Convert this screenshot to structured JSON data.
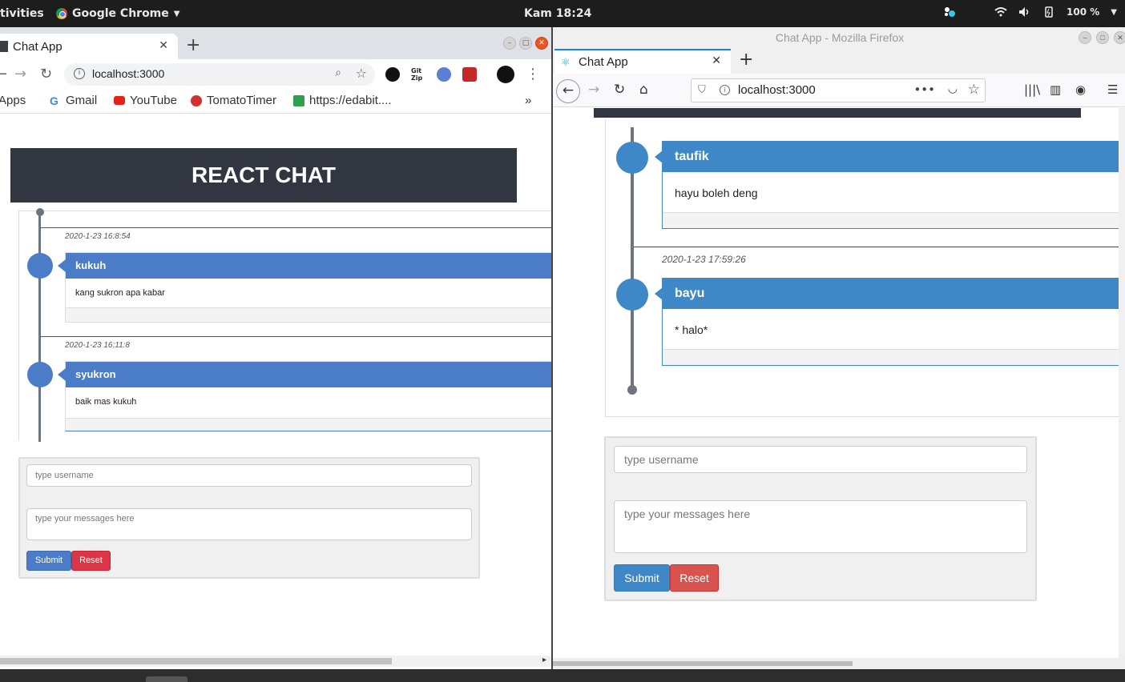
{
  "system": {
    "activities": "tivities",
    "app_name": "Google Chrome",
    "clock": "Kam 18:24",
    "battery": "100 %"
  },
  "chrome": {
    "tab_title": "Chat App",
    "url": "localhost:3000",
    "bookmarks": [
      "Apps",
      "Gmail",
      "YouTube",
      "TomatoTimer",
      "https://edabit...."
    ],
    "page": {
      "header": "REACT CHAT",
      "messages": [
        {
          "date": "2020-1-23 16:8:54",
          "user": "kukuh",
          "text": "kang sukron apa kabar"
        },
        {
          "date": "2020-1-23 16:11:8",
          "user": "syukron",
          "text": "baik mas kukuh"
        }
      ],
      "form": {
        "username_placeholder": "type username",
        "message_placeholder": "type your messages here",
        "submit": "Submit",
        "reset": "Reset"
      }
    }
  },
  "firefox": {
    "window_title": "Chat App - Mozilla Firefox",
    "tab_title": "Chat App",
    "url": "localhost:3000",
    "page": {
      "messages": [
        {
          "date": "",
          "user": "taufik",
          "text": "hayu boleh deng"
        },
        {
          "date": "2020-1-23 17:59:26",
          "user": "bayu",
          "text": "* halo*"
        }
      ],
      "form": {
        "username_placeholder": "type username",
        "message_placeholder": "type your messages here",
        "submit": "Submit",
        "reset": "Reset"
      }
    }
  },
  "colors": {
    "chrome_card_header": "#4a7cc7",
    "firefox_card_header": "#3e88c8",
    "badge_dot": "#a6c41c",
    "header_bg": "#323640"
  }
}
